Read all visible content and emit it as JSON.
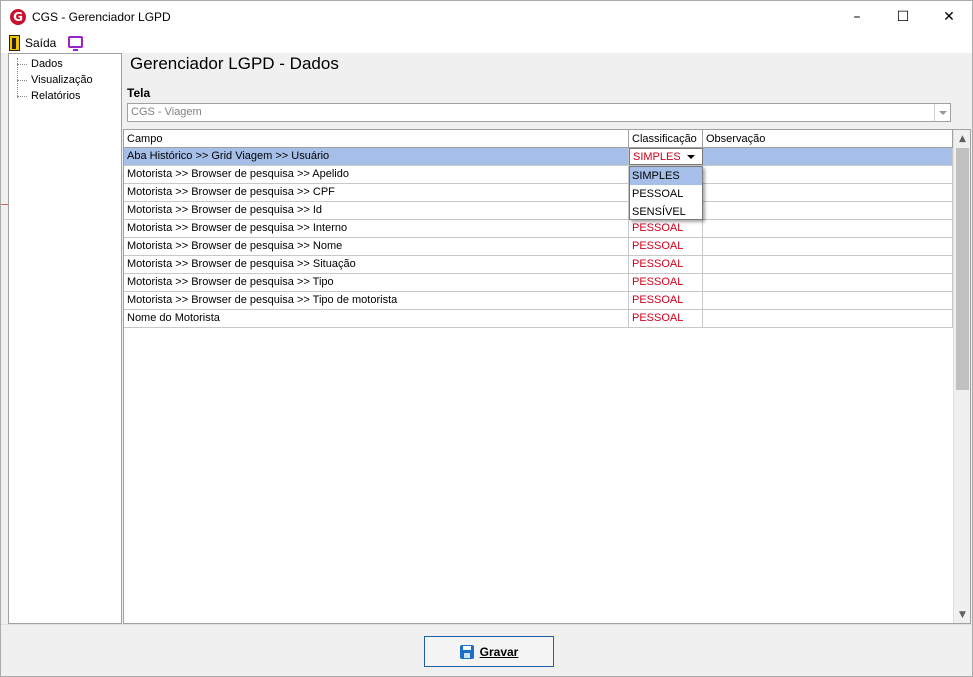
{
  "window": {
    "title": "CGS - Gerenciador LGPD",
    "app_icon_letter": "G",
    "controls": {
      "minimize": "–",
      "maximize": "☐",
      "close": "✕"
    }
  },
  "menu": {
    "exit_label": "Saída"
  },
  "sidebar": {
    "items": [
      {
        "label": "Dados"
      },
      {
        "label": "Visualização"
      },
      {
        "label": "Relatórios"
      }
    ]
  },
  "main": {
    "title": "Gerenciador LGPD - Dados",
    "tela_label": "Tela",
    "tela_value": "CGS - Viagem"
  },
  "grid": {
    "columns": [
      "Campo",
      "Classificação",
      "Observação"
    ],
    "editing_value": "SIMPLES",
    "rows": [
      {
        "campo": "Aba Histórico >> Grid Viagem >> Usuário",
        "classificacao": "SIMPLES",
        "observacao": ""
      },
      {
        "campo": "Motorista >> Browser de pesquisa >> Apelido",
        "classificacao": "",
        "observacao": ""
      },
      {
        "campo": "Motorista >> Browser de pesquisa >> CPF",
        "classificacao": "",
        "observacao": ""
      },
      {
        "campo": "Motorista >> Browser de pesquisa >> Id",
        "classificacao": "",
        "observacao": ""
      },
      {
        "campo": "Motorista >> Browser de pesquisa >> Interno",
        "classificacao": "PESSOAL",
        "observacao": ""
      },
      {
        "campo": "Motorista >> Browser de pesquisa >> Nome",
        "classificacao": "PESSOAL",
        "observacao": ""
      },
      {
        "campo": "Motorista >> Browser de pesquisa >> Situação",
        "classificacao": "PESSOAL",
        "observacao": ""
      },
      {
        "campo": "Motorista >> Browser de pesquisa >> Tipo",
        "classificacao": "PESSOAL",
        "observacao": ""
      },
      {
        "campo": "Motorista >> Browser de pesquisa >> Tipo de motorista",
        "classificacao": "PESSOAL",
        "observacao": ""
      },
      {
        "campo": "Nome do Motorista",
        "classificacao": "PESSOAL",
        "observacao": ""
      }
    ],
    "dropdown_options": [
      "SIMPLES",
      "PESSOAL",
      "SENSÍVEL"
    ],
    "dropdown_selected_index": 0
  },
  "footer": {
    "save_label": "Gravar"
  },
  "colors": {
    "classification_text": "#d0021b",
    "selection": "#a5bfe8",
    "brand_logo": "#c8102e"
  }
}
